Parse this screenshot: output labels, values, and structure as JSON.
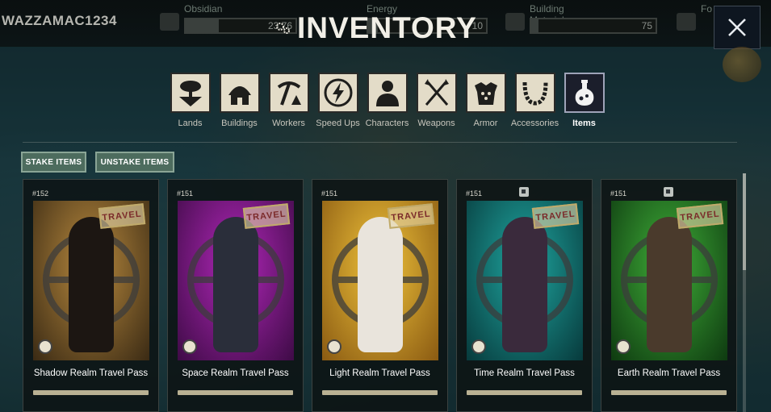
{
  "hud": {
    "username": "WAZZAMAC1234",
    "resources": [
      {
        "label": "Obsidian",
        "value": "23.76",
        "icon": "obsidian-icon"
      },
      {
        "label": "Energy",
        "value": "10",
        "icon": "energy-icon"
      },
      {
        "label": "Building Materials",
        "value": "75",
        "icon": "building-materials-icon"
      },
      {
        "label": "Fo",
        "value": "",
        "icon": "food-icon"
      }
    ]
  },
  "title": "INVENTORY",
  "close_label": "×",
  "categories": [
    {
      "label": "Lands",
      "icon": "tree-island-icon",
      "active": false
    },
    {
      "label": "Buildings",
      "icon": "hut-icon",
      "active": false
    },
    {
      "label": "Workers",
      "icon": "pickaxe-icon",
      "active": false
    },
    {
      "label": "Speed Ups",
      "icon": "lightning-icon",
      "active": false
    },
    {
      "label": "Characters",
      "icon": "person-icon",
      "active": false
    },
    {
      "label": "Weapons",
      "icon": "crossed-spears-icon",
      "active": false
    },
    {
      "label": "Armor",
      "icon": "armor-icon",
      "active": false
    },
    {
      "label": "Accessories",
      "icon": "necklace-icon",
      "active": false
    },
    {
      "label": "Items",
      "icon": "potion-icon",
      "active": true
    }
  ],
  "actions": {
    "stake": "STAKE ITEMS",
    "unstake": "UNSTAKE ITEMS"
  },
  "cards": [
    {
      "id": "#152",
      "name": "Shadow Realm Travel Pass",
      "stamp": "TRAVEL",
      "badge": false,
      "colors": [
        "#b98a3e",
        "#3a2a14"
      ],
      "figure": "#1c1612"
    },
    {
      "id": "#151",
      "name": "Space Realm Travel Pass",
      "stamp": "TRAVEL",
      "badge": false,
      "colors": [
        "#b027b8",
        "#3e0b46"
      ],
      "figure": "#2a2e3a"
    },
    {
      "id": "#151",
      "name": "Light Realm Travel Pass",
      "stamp": "TRAVEL",
      "badge": false,
      "colors": [
        "#f0c33a",
        "#8a5a12"
      ],
      "figure": "#e9e4dc"
    },
    {
      "id": "#151",
      "name": "Time Realm Travel Pass",
      "stamp": "TRAVEL",
      "badge": true,
      "colors": [
        "#1fa6a0",
        "#073a3c"
      ],
      "figure": "#3a2a3c"
    },
    {
      "id": "#151",
      "name": "Earth Realm Travel Pass",
      "stamp": "TRAVEL",
      "badge": true,
      "colors": [
        "#3fae38",
        "#0e3a10"
      ],
      "figure": "#4a3a2c"
    }
  ]
}
